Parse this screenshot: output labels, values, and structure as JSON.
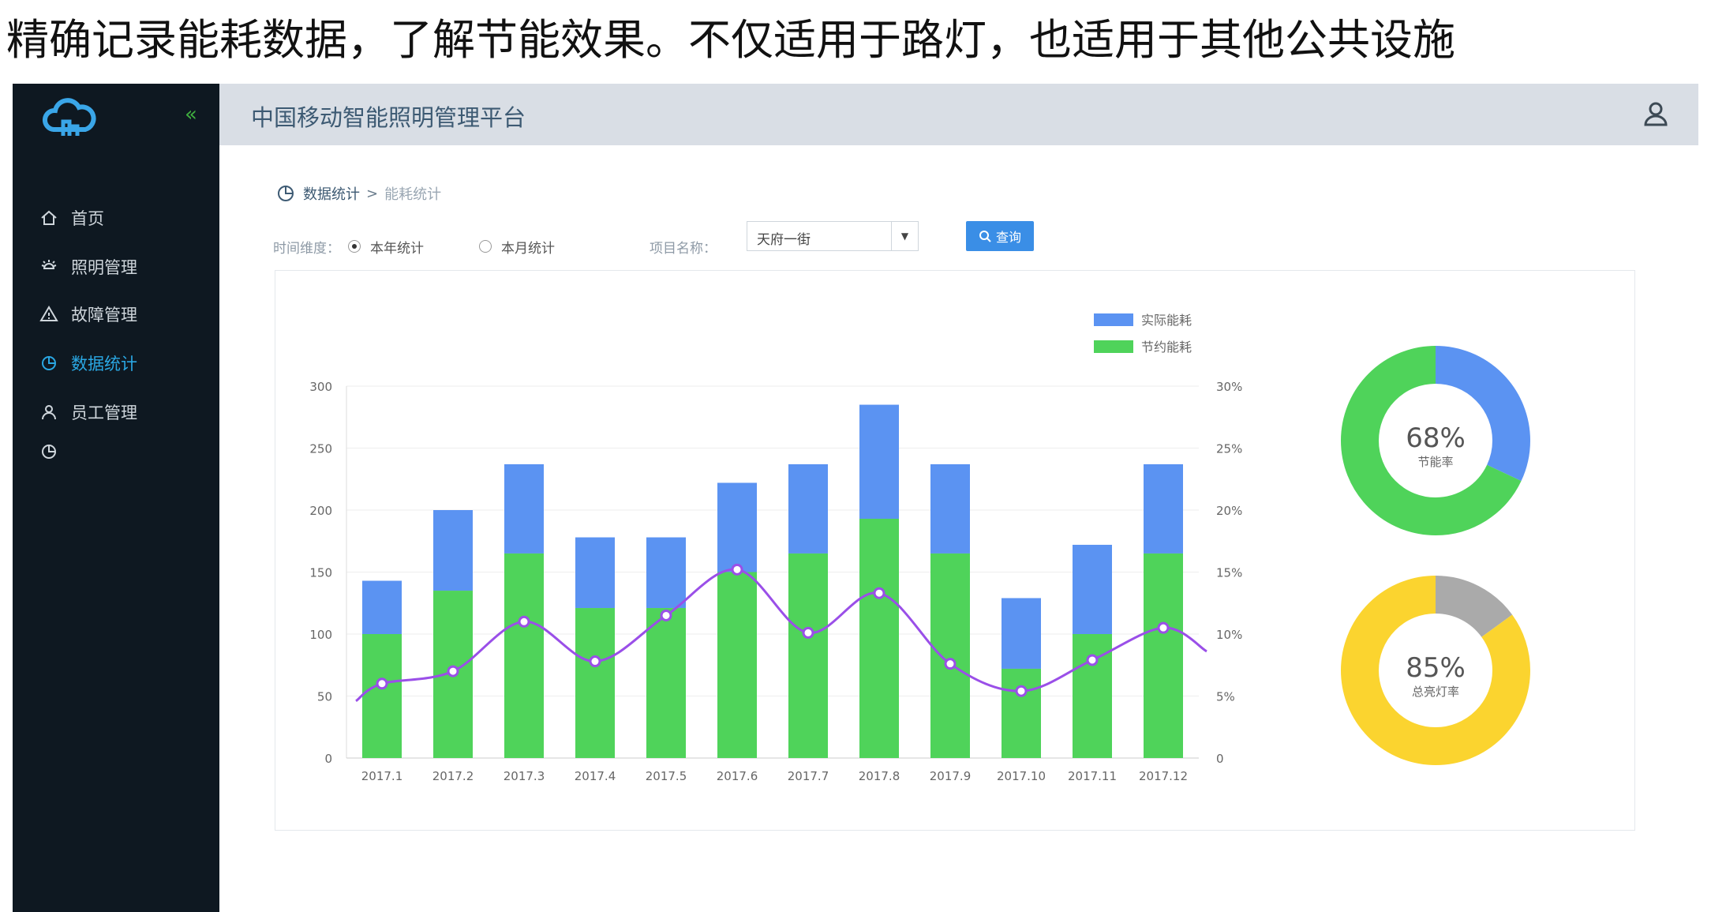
{
  "caption": "精确记录能耗数据，了解节能效果。不仅适用于路灯，也适用于其他公共设施",
  "sidebar": {
    "collapse_label": "«",
    "items": [
      {
        "label": "首页",
        "icon": "home-icon"
      },
      {
        "label": "照明管理",
        "icon": "light-icon"
      },
      {
        "label": "故障管理",
        "icon": "warning-icon"
      },
      {
        "label": "数据统计",
        "icon": "pie-icon",
        "active": true
      },
      {
        "label": "员工管理",
        "icon": "user-icon"
      },
      {
        "label": "",
        "icon": "pie-icon"
      }
    ]
  },
  "header": {
    "title": "中国移动智能照明管理平台"
  },
  "breadcrumb": {
    "parent": "数据统计",
    "separator": ">",
    "current": "能耗统计"
  },
  "filters": {
    "time_label": "时间维度：",
    "option_year": "本年统计",
    "option_month": "本月统计",
    "selected": "year",
    "project_label": "项目名称：",
    "project_value": "天府一街",
    "query_label": "查询"
  },
  "colors": {
    "actual": "#5b93f2",
    "saved": "#4fd35a",
    "line": "#9a4fe8",
    "gray": "#aaaaaa",
    "yellow": "#fbd42f"
  },
  "chart_data": [
    {
      "type": "bar",
      "categories": [
        "2017.1",
        "2017.2",
        "2017.3",
        "2017.4",
        "2017.5",
        "2017.6",
        "2017.7",
        "2017.8",
        "2017.9",
        "2017.10",
        "2017.11",
        "2017.12"
      ],
      "series": [
        {
          "name": "实际能耗",
          "values": [
            43,
            65,
            72,
            57,
            57,
            72,
            72,
            92,
            72,
            57,
            72,
            72
          ]
        },
        {
          "name": "节约能耗",
          "values": [
            100,
            135,
            165,
            121,
            121,
            150,
            165,
            193,
            165,
            72,
            100,
            165
          ]
        }
      ],
      "stacked": true,
      "line_series": {
        "axis": "right",
        "values": [
          6,
          7,
          11,
          7.8,
          11.5,
          15.2,
          10.1,
          13.3,
          7.6,
          5.4,
          7.9,
          10.5
        ],
        "start": 4.6,
        "end": 8.6
      },
      "ylim": [
        0,
        300
      ],
      "yticks": [
        0,
        50,
        100,
        150,
        200,
        250,
        300
      ],
      "y2lim": [
        0,
        30
      ],
      "y2ticks": [
        "0",
        "5%",
        "10%",
        "15%",
        "20%",
        "25%",
        "30%"
      ],
      "legend": "top-right"
    },
    {
      "type": "pie",
      "value_label": "68%",
      "label": "节能率",
      "values": [
        32,
        68
      ]
    },
    {
      "type": "pie",
      "value_label": "85%",
      "label": "总亮灯率",
      "values": [
        15,
        85
      ]
    }
  ]
}
